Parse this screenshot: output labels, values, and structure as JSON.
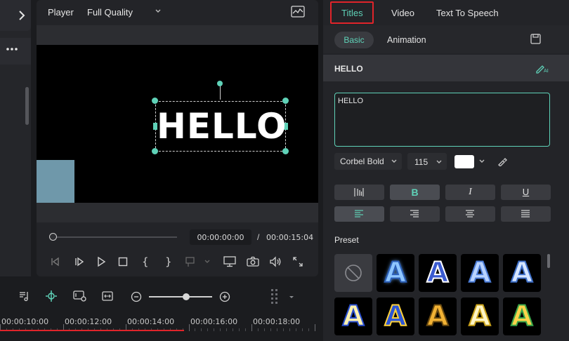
{
  "player": {
    "label": "Player",
    "quality": "Full Quality",
    "current_time": "00:00:00:00",
    "separator": "/",
    "total_time": "00:00:15:04",
    "preview_text": "HELLO"
  },
  "timeline": {
    "ruler_labels": [
      "00:00:10:00",
      "00:00:12:00",
      "00:00:14:00",
      "00:00:16:00",
      "00:00:18:00"
    ]
  },
  "right_panel": {
    "tabs": [
      "Titles",
      "Video",
      "Text To Speech"
    ],
    "subtabs": [
      "Basic",
      "Animation"
    ],
    "section_title": "HELLO",
    "text_value": "HELLO",
    "font_family": "Corbel Bold",
    "font_size": "115",
    "color": "#ffffff",
    "preset_label": "Preset",
    "bold_label": "B",
    "italic_label": "I",
    "underline_label": "U",
    "ai_label": "AI"
  },
  "colors": {
    "accent": "#5fd2b8",
    "highlight_box": "#e0242a",
    "playhead": "#e0242a"
  },
  "icons": {
    "collapse": "chevron-right-icon",
    "more": "more-horizontal-icon",
    "chart": "waveform-chart-icon",
    "save_preset": "save-icon",
    "ai_edit": "ai-pen-icon",
    "eyedropper": "eyedropper-icon"
  }
}
